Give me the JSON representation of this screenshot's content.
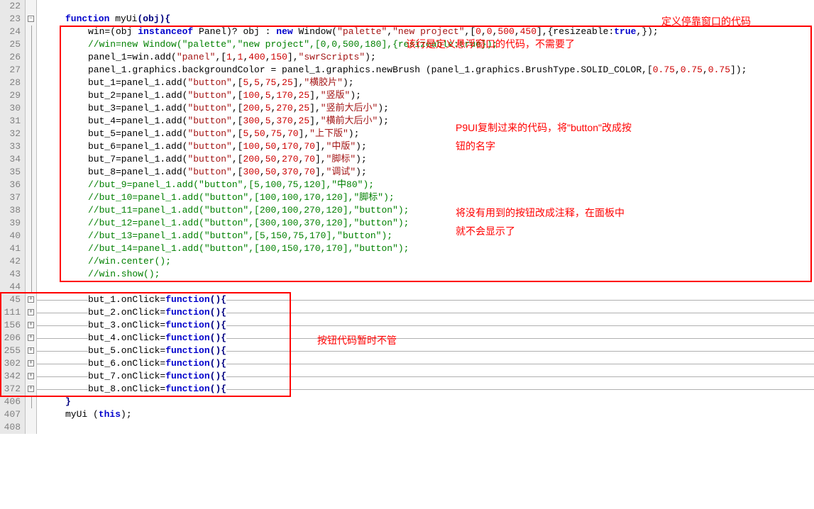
{
  "lineNumbers": [
    "22",
    "23",
    "24",
    "25",
    "26",
    "27",
    "28",
    "29",
    "30",
    "31",
    "32",
    "33",
    "34",
    "35",
    "36",
    "37",
    "38",
    "39",
    "40",
    "41",
    "42",
    "43",
    "44",
    "45",
    "111",
    "156",
    "206",
    "255",
    "302",
    "342",
    "372",
    "406",
    "407",
    "408"
  ],
  "code": {
    "l23_fn": "function",
    "l23_name": " myUi",
    "l23_param": "(obj){",
    "l24_pre": "win=(obj ",
    "l24_inst": "instanceof",
    "l24_mid": " Panel)? obj : ",
    "l24_new": "new",
    "l24_win": " Window(",
    "l24_s1": "\"palette\"",
    "l24_c1": ",",
    "l24_s2": "\"new project\"",
    "l24_c2": ",[",
    "l24_n1": "0",
    "l24_c3": ",",
    "l24_n2": "0",
    "l24_c4": ",",
    "l24_n3": "500",
    "l24_c5": ",",
    "l24_n4": "450",
    "l24_c6": "],{resizeable:",
    "l24_true": "true",
    "l24_end": ",});",
    "l25": "//win=new Window(\"palette\",\"new project\",[0,0,500,180],{resizeable:true});",
    "l26_pre": "panel_1=win.add(",
    "l26_s1": "\"panel\"",
    "l26_c1": ",[",
    "l26_n1": "1",
    "l26_c2": ",",
    "l26_n2": "1",
    "l26_c3": ",",
    "l26_n3": "400",
    "l26_c4": ",",
    "l26_n4": "150",
    "l26_c5": "],",
    "l26_s2": "\"swrScripts\"",
    "l26_end": ");",
    "l27_pre": "panel_1.graphics.backgroundColor = panel_1.graphics.newBrush (panel_1.graphics.BrushType.SOLID_COLOR,[",
    "l27_n1": "0.75",
    "l27_c1": ",",
    "l27_n2": "0.75",
    "l27_c2": ",",
    "l27_n3": "0.75",
    "l27_end": "]);",
    "l28": {
      "v": "but_1=panel_1.add(",
      "s": "\"button\"",
      "c1": ",[",
      "n": [
        "5",
        "5",
        "75",
        "25"
      ],
      "c2": "],",
      "s2": "\"横胶片\"",
      "e": ");"
    },
    "l29": {
      "v": "but_2=panel_1.add(",
      "s": "\"button\"",
      "c1": ",[",
      "n": [
        "100",
        "5",
        "170",
        "25"
      ],
      "c2": "],",
      "s2": "\"竖版\"",
      "e": ");"
    },
    "l30": {
      "v": "but_3=panel_1.add(",
      "s": "\"button\"",
      "c1": ",[",
      "n": [
        "200",
        "5",
        "270",
        "25"
      ],
      "c2": "],",
      "s2": "\"竖前大后小\"",
      "e": ");"
    },
    "l31": {
      "v": "but_4=panel_1.add(",
      "s": "\"button\"",
      "c1": ",[",
      "n": [
        "300",
        "5",
        "370",
        "25"
      ],
      "c2": "],",
      "s2": "\"横前大后小\"",
      "e": ");"
    },
    "l32": {
      "v": "but_5=panel_1.add(",
      "s": "\"button\"",
      "c1": ",[",
      "n": [
        "5",
        "50",
        "75",
        "70"
      ],
      "c2": "],",
      "s2": "\"上下版\"",
      "e": ");"
    },
    "l33": {
      "v": "but_6=panel_1.add(",
      "s": "\"button\"",
      "c1": ",[",
      "n": [
        "100",
        "50",
        "170",
        "70"
      ],
      "c2": "],",
      "s2": "\"中版\"",
      "e": ");"
    },
    "l34": {
      "v": "but_7=panel_1.add(",
      "s": "\"button\"",
      "c1": ",[",
      "n": [
        "200",
        "50",
        "270",
        "70"
      ],
      "c2": "],",
      "s2": "\"脚标\"",
      "e": ");"
    },
    "l35": {
      "v": "but_8=panel_1.add(",
      "s": "\"button\"",
      "c1": ",[",
      "n": [
        "300",
        "50",
        "370",
        "70"
      ],
      "c2": "],",
      "s2": "\"调试\"",
      "e": ");"
    },
    "l36": "//but_9=panel_1.add(\"button\",[5,100,75,120],\"中80\");",
    "l37": "//but_10=panel_1.add(\"button\",[100,100,170,120],\"脚标\");",
    "l38": "//but_11=panel_1.add(\"button\",[200,100,270,120],\"button\");",
    "l39": "//but_12=panel_1.add(\"button\",[300,100,370,120],\"button\");",
    "l40": "//but_13=panel_1.add(\"button\",[5,150,75,170],\"button\");",
    "l41": "//but_14=panel_1.add(\"button\",[100,150,170,170],\"button\");",
    "l42": "//win.center();",
    "l43": "//win.show();",
    "onclick": [
      "but_1.onClick=",
      "but_2.onClick=",
      "but_3.onClick=",
      "but_4.onClick=",
      "but_5.onClick=",
      "but_6.onClick=",
      "but_7.onClick=",
      "but_8.onClick="
    ],
    "fnkw": "function",
    "fnparen": "(){",
    "l406": "}",
    "l407_pre": "myUi (",
    "l407_this": "this",
    "l407_end": ");"
  },
  "annotations": {
    "a1": "定义停靠窗口的代码",
    "a2": "该行是定义悬浮窗口的代码，不需要了",
    "a3_l1": "P9UI复制过来的代码，将\"button\"改成按",
    "a3_l2": "钮的名字",
    "a4_l1": "将没有用到的按钮改成注释，在面板中",
    "a4_l2": "就不会显示了",
    "a5": "按钮代码暂时不管"
  }
}
